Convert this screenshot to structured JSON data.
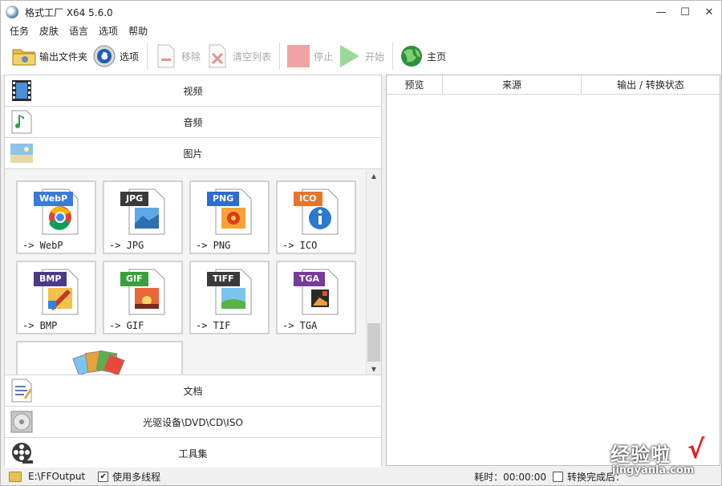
{
  "window": {
    "title": "格式工厂 X64 5.6.0",
    "minimize": "—",
    "maximize": "☐",
    "close": "✕"
  },
  "menu": [
    "任务",
    "皮肤",
    "语言",
    "选项",
    "帮助"
  ],
  "toolbar": {
    "output_folder": "输出文件夹",
    "options": "选项",
    "remove": "移除",
    "clear_list": "清空列表",
    "stop": "停止",
    "start": "开始",
    "home": "主页"
  },
  "categories_top": [
    {
      "label": "视频",
      "icon": "film-icon"
    },
    {
      "label": "音频",
      "icon": "music-note-icon"
    },
    {
      "label": "图片",
      "icon": "picture-icon"
    }
  ],
  "image_formats": [
    {
      "tag": "WebP",
      "label": "-> WebP",
      "color": "#3a7bd5",
      "icon": "chrome-icon"
    },
    {
      "tag": "JPG",
      "label": "-> JPG",
      "color": "#3a3a3a",
      "icon": "landscape-icon"
    },
    {
      "tag": "PNG",
      "label": "-> PNG",
      "color": "#2d6bcf",
      "icon": "flower-icon"
    },
    {
      "tag": "ICO",
      "label": "-> ICO",
      "color": "#e8752a",
      "icon": "info-icon"
    },
    {
      "tag": "BMP",
      "label": "-> BMP",
      "color": "#4a3a8a",
      "icon": "paint-icon"
    },
    {
      "tag": "GIF",
      "label": "-> GIF",
      "color": "#3aa03a",
      "icon": "sunset-icon"
    },
    {
      "tag": "TIFF",
      "label": "-> TIF",
      "color": "#3a3a3a",
      "icon": "meadow-icon"
    },
    {
      "tag": "TGA",
      "label": "-> TGA",
      "color": "#7a3a9a",
      "icon": "photo-icon"
    }
  ],
  "categories_bottom": [
    {
      "label": "文档",
      "icon": "document-icon"
    },
    {
      "label": "光驱设备\\DVD\\CD\\ISO",
      "icon": "disc-icon"
    },
    {
      "label": "工具集",
      "icon": "film-reel-icon"
    }
  ],
  "table": {
    "columns": [
      "预览",
      "来源",
      "输出 / 转换状态"
    ]
  },
  "status": {
    "output_path": "E:\\FFOutput",
    "multithread_label": "使用多线程",
    "multithread_checked": "✔",
    "elapsed": "耗时：00:00:00",
    "after_convert": "转换完成后："
  },
  "watermark": {
    "cn": "经验啦",
    "check": "√",
    "en": "jingyanla.com"
  }
}
